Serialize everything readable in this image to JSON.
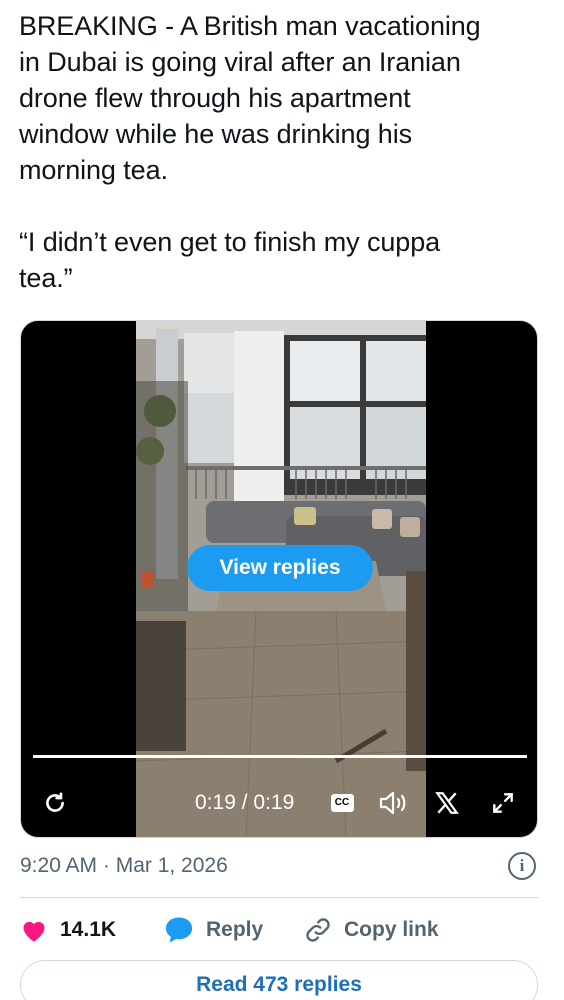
{
  "tweet": {
    "lines": [
      "BREAKING - A British man vacationing",
      "in Dubai is going viral after an Iranian",
      "drone flew through his apartment",
      "window while he was drinking his",
      "morning tea."
    ],
    "quote_lines": [
      "“I didn’t even get to finish my cuppa",
      "tea.”"
    ]
  },
  "video": {
    "view_replies_label": "View replies",
    "time_display": "0:19 / 0:19",
    "progress_fraction": 1.0,
    "cc_label": "CC",
    "icons": [
      "replay-icon",
      "cc-icon",
      "volume-icon",
      "x-logo-icon",
      "expand-icon"
    ]
  },
  "meta": {
    "timestamp": "9:20 AM · Mar 1, 2026",
    "info_icon": "i"
  },
  "actions": {
    "likes_count": "14.1K",
    "reply_label": "Reply",
    "copy_link_label": "Copy link"
  },
  "footer": {
    "read_replies_label": "Read 473 replies"
  },
  "colors": {
    "accent": "#1d9bf0",
    "heart": "#f91880",
    "muted": "#536471",
    "text": "#0f1419",
    "border": "#cfd9de"
  }
}
